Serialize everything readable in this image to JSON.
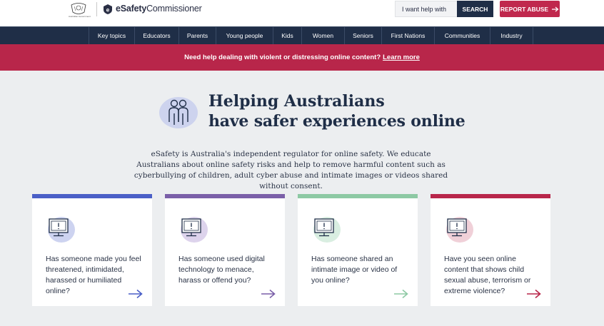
{
  "header": {
    "gov_label": "Australian Government",
    "brand_bold": "eSafety",
    "brand_rest": "Commissioner",
    "search_placeholder": "I want help with",
    "search_label": "SEARCH",
    "report_label": "REPORT ABUSE"
  },
  "nav": {
    "items": [
      "Key topics",
      "Educators",
      "Parents",
      "Young people",
      "Kids",
      "Women",
      "Seniors",
      "First Nations",
      "Communities",
      "Industry"
    ]
  },
  "alert": {
    "text": "Need help dealing with violent or distressing online content?",
    "link": "Learn more"
  },
  "hero": {
    "title_line1": "Helping Australians",
    "title_line2": "have safer experiences online",
    "intro": "eSafety is Australia's independent regulator for online safety. We educate Australians about online safety risks and help to remove harmful content such as cyberbullying of children, adult cyber abuse and intimate images or videos shared without consent."
  },
  "cards": [
    {
      "text": "Has someone made you feel threatened, intimidated, harassed or humiliated online?",
      "color": "#4a5fc7",
      "blob": "#cdd3f0"
    },
    {
      "text": "Has someone used digital technology to menace, harass or offend you?",
      "color": "#7a5fa8",
      "blob": "#ddd3ec"
    },
    {
      "text": "Has someone shared an intimate image or video of you online?",
      "color": "#8dc9a4",
      "blob": "#d9eee1"
    },
    {
      "text": "Have you seen online content that shows child sexual abuse, terrorism or extreme violence?",
      "color": "#b8264a",
      "blob": "#f0d0d8"
    }
  ],
  "colors": {
    "navy": "#1f2e47",
    "crimson": "#b8264a",
    "page_bg": "#eceef0"
  }
}
